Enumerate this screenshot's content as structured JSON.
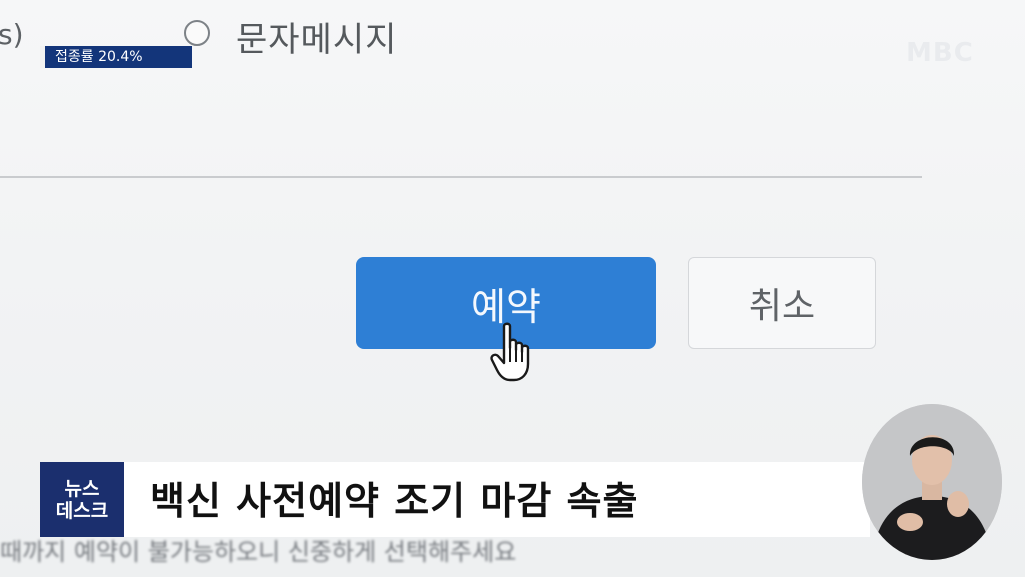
{
  "form": {
    "partial_left_text": "s)",
    "radio_option_label": "문자메시지"
  },
  "buttons": {
    "reserve_label": "예약",
    "cancel_label": "취소"
  },
  "background_text": "때까지 예약이 불가능하오니 신중하게 선택해주세요",
  "overlay": {
    "vaccination_rate": "접종률 20.4%",
    "broadcaster_logo": "MBC",
    "program_logo_line1": "뉴스",
    "program_logo_line2": "데스크",
    "headline": "백신 사전예약 조기 마감 속출"
  },
  "colors": {
    "reserve_button": "#2e7fd5",
    "badge_bg": "#13357a",
    "program_logo_bg": "#1b2f6e"
  },
  "icons": {
    "cursor": "hand-pointer-icon",
    "radio": "radio-button"
  }
}
